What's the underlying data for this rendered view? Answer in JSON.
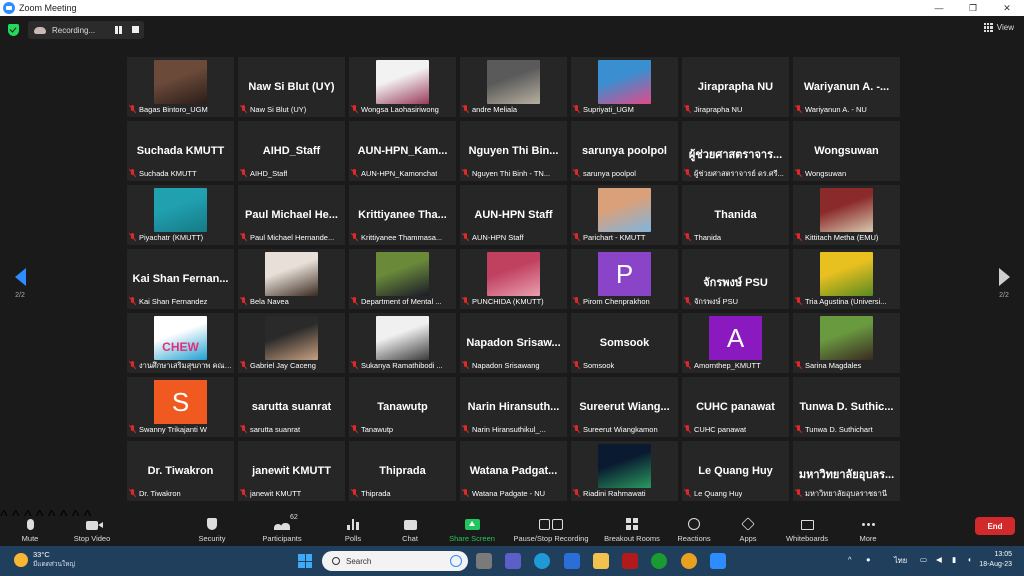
{
  "window": {
    "title": "Zoom Meeting",
    "controls": [
      "—",
      "❐",
      "✕"
    ]
  },
  "topbar": {
    "recording_label": "Recording...",
    "view_label": "View"
  },
  "nav": {
    "page_indicator": "2/2"
  },
  "participants": [
    {
      "label": "Bagas Bintoro_UGM",
      "photo": [
        "#6b4a3a",
        "#2a1d18"
      ]
    },
    {
      "label": "Naw Si Blut (UY)",
      "big": "Naw Si Blut (UY)"
    },
    {
      "label": "Wongsa Laohasiriwong",
      "photo": [
        "#f2f2f2",
        "#9a3a5a"
      ]
    },
    {
      "label": "andre Meliala",
      "photo": [
        "#5a5a5a",
        "#b8b0a0"
      ]
    },
    {
      "label": "Supriyati_UGM",
      "photo": [
        "#3a8fd0",
        "#e14a8a"
      ]
    },
    {
      "label": "Jiraprapha NU",
      "big": "Jiraprapha NU"
    },
    {
      "label": "Wariyanun A. - NU",
      "big": "Wariyanun A. -..."
    },
    {
      "label": "Suchada KMUTT",
      "big": "Suchada KMUTT"
    },
    {
      "label": "AIHD_Staff",
      "big": "AIHD_Staff"
    },
    {
      "label": "AUN-HPN_Kamonchat",
      "big": "AUN-HPN_Kam..."
    },
    {
      "label": "Nguyen Thi Binh - TN...",
      "big": "Nguyen Thi Bin..."
    },
    {
      "label": "sarunya poolpol",
      "big": "sarunya poolpol"
    },
    {
      "label": "ผู้ช่วยศาสตราจารย์ ดร.ศรี...",
      "big": "ผู้ช่วยศาสตราจาร..."
    },
    {
      "label": "Wongsuwan",
      "big": "Wongsuwan"
    },
    {
      "label": "Piyachatr (KMUTT)",
      "photo": [
        "#21a0b0",
        "#157a86"
      ]
    },
    {
      "label": "Paul Michael Hernande...",
      "big": "Paul Michael He..."
    },
    {
      "label": "Krittiyanee Thammasa...",
      "big": "Krittiyanee Tha..."
    },
    {
      "label": "AUN-HPN Staff",
      "big": "AUN-HPN Staff"
    },
    {
      "label": "Parichart - KMUTT",
      "photo": [
        "#d9a07a",
        "#7fb5e0"
      ]
    },
    {
      "label": "Thanida",
      "big": "Thanida"
    },
    {
      "label": "Kittitach Metha (EMU)",
      "photo": [
        "#8a2a2a",
        "#d8c8b0"
      ]
    },
    {
      "label": "Kai Shan Fernandez",
      "big": "Kai Shan Fernan..."
    },
    {
      "label": "Bela Navea",
      "photo": [
        "#e8e0d8",
        "#3a2a20"
      ]
    },
    {
      "label": "Department of Mental ...",
      "photo": [
        "#6a8a3a",
        "#1a1a2a"
      ]
    },
    {
      "label": "PUNCHIDA (KMUTT)",
      "photo": [
        "#c04060",
        "#e8a0b0"
      ]
    },
    {
      "label": "Pirom Chenprakhon",
      "letter": "P",
      "letter_color": "#8a44c8"
    },
    {
      "label": "จักรพงษ์ PSU",
      "big": "จักรพงษ์ PSU"
    },
    {
      "label": "Tria Agustina (Universi...",
      "photo": [
        "#e8c020",
        "#5a8a20"
      ]
    },
    {
      "label": "งานศึกษาเสริมสุขภาพ คณะ...",
      "photo": [
        "#ffffff",
        "#1ea0d0"
      ],
      "logo_text": "CHEW"
    },
    {
      "label": "Gabriel Jay Caceng",
      "photo": [
        "#2a2a2a",
        "#c8a080"
      ]
    },
    {
      "label": "Sukanya Ramathibodi ...",
      "photo": [
        "#f0f0f0",
        "#3a3a3a"
      ]
    },
    {
      "label": "Napadon Srisawang",
      "big": "Napadon Srisaw..."
    },
    {
      "label": "Somsook",
      "big": "Somsook"
    },
    {
      "label": "Amornthep_KMUTT",
      "letter": "A",
      "letter_color": "#8a1ac0"
    },
    {
      "label": "Sarina Magdales",
      "photo": [
        "#6a9a40",
        "#3a2a20"
      ]
    },
    {
      "label": "Swanny Trikajanti W",
      "letter": "S",
      "letter_color": "#f05a20"
    },
    {
      "label": "sarutta suanrat",
      "big": "sarutta suanrat"
    },
    {
      "label": "Tanawutp",
      "big": "Tanawutp"
    },
    {
      "label": "Narin Hiransuthikul_...",
      "big": "Narin Hiransuth..."
    },
    {
      "label": "Sureerut Wiangkamon",
      "big": "Sureerut Wiang..."
    },
    {
      "label": "CUHC panawat",
      "big": "CUHC panawat"
    },
    {
      "label": "Tunwa D. Suthichart",
      "big": "Tunwa D. Suthic..."
    },
    {
      "label": "Dr. Tiwakron",
      "big": "Dr. Tiwakron"
    },
    {
      "label": "janewit KMUTT",
      "big": "janewit KMUTT"
    },
    {
      "label": "Thiprada",
      "big": "Thiprada"
    },
    {
      "label": "Watana Padgate - NU",
      "big": "Watana Padgat..."
    },
    {
      "label": "Riadini Rahmawati",
      "photo": [
        "#0a1a30",
        "#2a9a60"
      ]
    },
    {
      "label": "Le Quang Huy",
      "big": "Le Quang Huy"
    },
    {
      "label": "มหาวิทยาลัยอุบลราชธานี",
      "big": "มหาวิทยาลัยอุบลร..."
    }
  ],
  "toolbar": {
    "mute": "Mute",
    "stop_video": "Stop Video",
    "security": "Security",
    "participants": "Participants",
    "participants_count": "62",
    "polls": "Polls",
    "chat": "Chat",
    "share_screen": "Share Screen",
    "record": "Pause/Stop Recording",
    "breakout": "Breakout Rooms",
    "reactions": "Reactions",
    "apps": "Apps",
    "whiteboards": "Whiteboards",
    "more": "More",
    "end": "End"
  },
  "taskbar": {
    "temperature": "33°C",
    "weather_desc": "มีแดดส่วนใหญ่",
    "search_placeholder": "Search",
    "lang": "ไทย",
    "time": "13:05",
    "date": "18-Aug-23"
  },
  "colors": {
    "accent": "#2d8cff",
    "share_green": "#22c55e",
    "end_red": "#d2292b",
    "muted_red": "#e02828"
  }
}
